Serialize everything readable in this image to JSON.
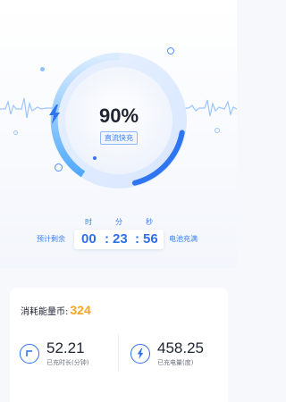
{
  "gauge": {
    "percent": 0.9,
    "percent_label": "90%",
    "mode_badge": "直流快充"
  },
  "timer": {
    "head_hour": "时",
    "head_min": "分",
    "head_sec": "秒",
    "left_label": "预计剩余",
    "right_label": "电池充满",
    "hours": "00",
    "minutes": "23",
    "seconds": "56",
    "sep": ":"
  },
  "summary": {
    "consume_label": "消耗能量币:",
    "consume_value": "324",
    "duration_value": "52.21",
    "duration_label": "已充时长(分钟)",
    "energy_value": "458.25",
    "energy_label": "已充电量(度)"
  },
  "colors": {
    "accent_blue": "#2f6fe8",
    "coin_orange": "#f5a623"
  },
  "icons": {
    "gauge": "lightning-bolt-icon",
    "duration": "clock-corner-icon",
    "energy": "lightning-bolt-icon"
  }
}
